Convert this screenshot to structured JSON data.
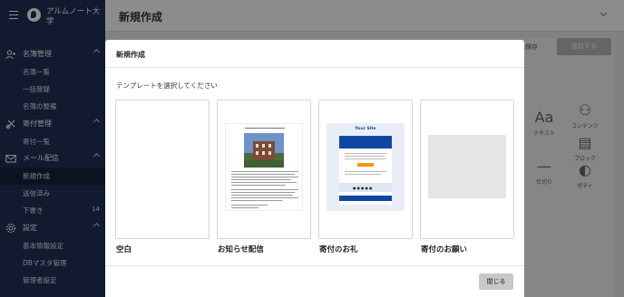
{
  "sidebar": {
    "brand_name": "アルムノート大学",
    "groups": [
      {
        "label": "名簿管理",
        "items": [
          {
            "label": "名簿一覧"
          },
          {
            "label": "一括登録"
          },
          {
            "label": "名簿の整備"
          }
        ]
      },
      {
        "label": "寄付管理",
        "items": [
          {
            "label": "寄付一覧"
          }
        ]
      },
      {
        "label": "メール配信",
        "items": [
          {
            "label": "新規作成"
          },
          {
            "label": "送信済み"
          },
          {
            "label": "下書き",
            "count": "14"
          }
        ]
      },
      {
        "label": "設定",
        "items": [
          {
            "label": "基本情報設定"
          },
          {
            "label": "DBマスタ管理"
          },
          {
            "label": "管理者設定"
          }
        ]
      }
    ]
  },
  "header": {
    "title": "新規作成"
  },
  "background": {
    "save_label": "へ保存",
    "send_label": "送信する",
    "blocks": [
      {
        "label": "テキスト",
        "icon": "Aa"
      },
      {
        "label": "コンテンツ",
        "icon": "content-icon"
      },
      {
        "label": "ブロック",
        "icon": "block-icon"
      },
      {
        "label": "仕切り",
        "icon": "divider-icon"
      },
      {
        "label": "ボディ",
        "icon": "palette-icon"
      }
    ]
  },
  "modal": {
    "title": "新規作成",
    "instruction": "テンプレートを選択してください",
    "templates": [
      {
        "label": "空白"
      },
      {
        "label": "お知らせ配信"
      },
      {
        "label": "寄付のお礼",
        "preview_heading": "Your Site",
        "accent": "#0e47a1",
        "button": "#f7931e"
      },
      {
        "label": "寄付のお願い"
      }
    ],
    "close_label": "閉じる"
  },
  "colors": {
    "sidebar": "#1f3156",
    "sidebar_active": "#15233f",
    "overlay": "#000000"
  }
}
